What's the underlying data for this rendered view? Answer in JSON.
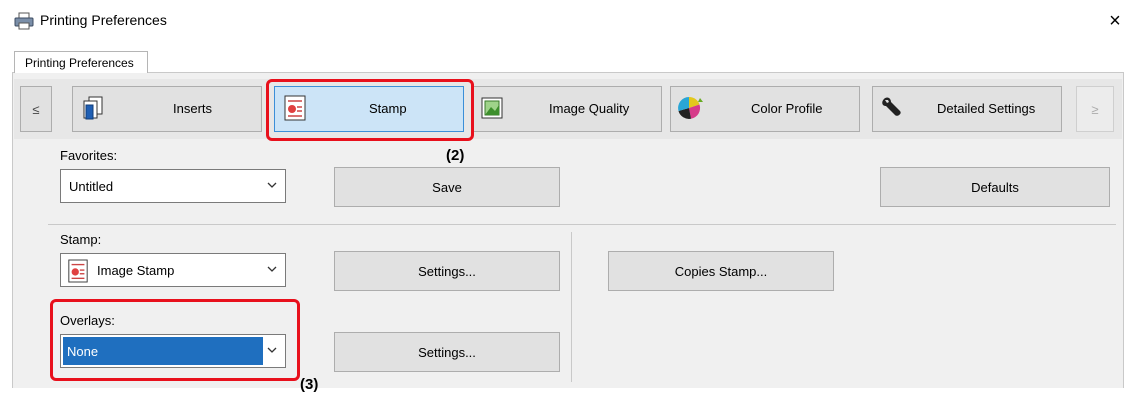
{
  "window": {
    "title": "Printing Preferences",
    "close_glyph": "×"
  },
  "tab": {
    "label": "Printing Preferences"
  },
  "toolbar": {
    "prev_glyph": "≤",
    "next_glyph": "≥",
    "buttons": [
      {
        "label": "Inserts",
        "icon": "inserts-icon"
      },
      {
        "label": "Stamp",
        "icon": "stamp-icon"
      },
      {
        "label": "Image Quality",
        "icon": "image-quality-icon"
      },
      {
        "label": "Color Profile",
        "icon": "color-profile-icon"
      },
      {
        "label": "Detailed Settings",
        "icon": "wrench-icon"
      }
    ]
  },
  "favorites": {
    "label": "Favorites:",
    "value": "Untitled",
    "save_label": "Save",
    "defaults_label": "Defaults"
  },
  "stamp": {
    "label": "Stamp:",
    "value": "Image Stamp",
    "settings_label": "Settings...",
    "copies_stamp_label": "Copies Stamp..."
  },
  "overlays": {
    "label": "Overlays:",
    "value": "None",
    "settings_label": "Settings..."
  },
  "callouts": {
    "c2": "(2)",
    "c3": "(3)"
  },
  "colors": {
    "highlight": "#e8101c",
    "selection": "#1f6fbf",
    "stamp_selected": "#cce4f7"
  }
}
